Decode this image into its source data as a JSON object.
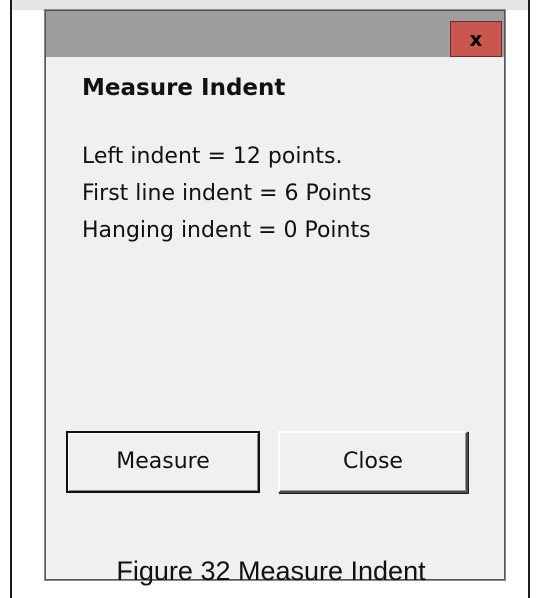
{
  "dialog": {
    "title": "Measure Indent",
    "close_glyph": "x",
    "lines": [
      "Left indent = 12 points.",
      "First line indent = 6 Points",
      "Hanging indent = 0 Points"
    ],
    "buttons": {
      "measure": "Measure",
      "close": "Close"
    }
  },
  "caption": "Figure 32 Measure Indent",
  "colors": {
    "titlebar": "#9e9e9e",
    "close_button": "#c9574f",
    "dialog_background": "#f0f0f0"
  },
  "icons": {
    "close": "close-icon"
  }
}
